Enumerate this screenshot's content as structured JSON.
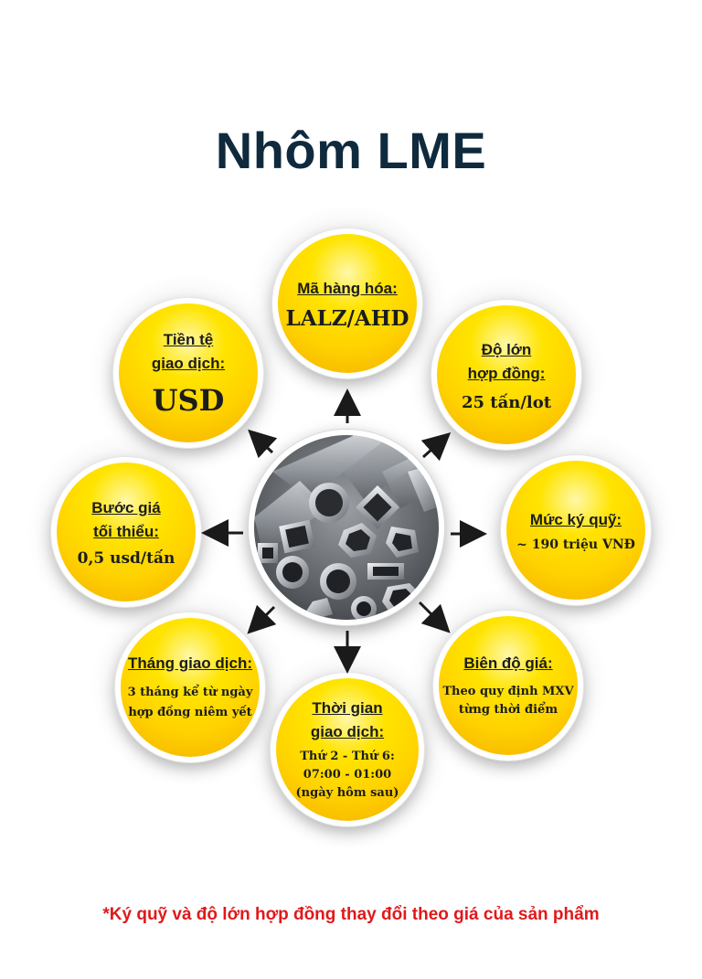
{
  "title": "Nhôm LME",
  "center_image": "aluminium-tubes-image",
  "bubbles": {
    "ma_hang": {
      "label": "Mã hàng hóa:",
      "value": "LALZ/AHD"
    },
    "do_lon": {
      "label_1": "Độ lớn",
      "label_2": "hợp đồng:",
      "value": "25 tấn/lot"
    },
    "ky_quy": {
      "label": "Mức ký quỹ:",
      "value": "~ 190 triệu VNĐ"
    },
    "bien_do": {
      "label": "Biên độ giá:",
      "value_1": "Theo quy định MXV",
      "value_2": "từng thời điểm"
    },
    "thoi_gian": {
      "label_1": "Thời gian",
      "label_2": "giao dịch:",
      "value_1": "Thứ 2 - Thứ 6:",
      "value_2": "07:00 - 01:00",
      "value_3": "(ngày hôm sau)"
    },
    "thang": {
      "label": "Tháng giao dịch:",
      "value_1": "3 tháng kể từ ngày",
      "value_2": "hợp đồng niêm yết"
    },
    "buoc_gia": {
      "label_1": "Bước giá",
      "label_2": "tối thiểu:",
      "value": "0,5 usd/tấn"
    },
    "tien_te": {
      "label_1": "Tiền tệ",
      "label_2": "giao dịch:",
      "value": "USD"
    }
  },
  "footnote": "*Ký quỹ và độ lớn hợp đồng thay đổi theo giá của sản phẩm",
  "colors": {
    "title": "#0f2a3d",
    "bubble": "#ffd200",
    "footnote": "#e0191b"
  }
}
